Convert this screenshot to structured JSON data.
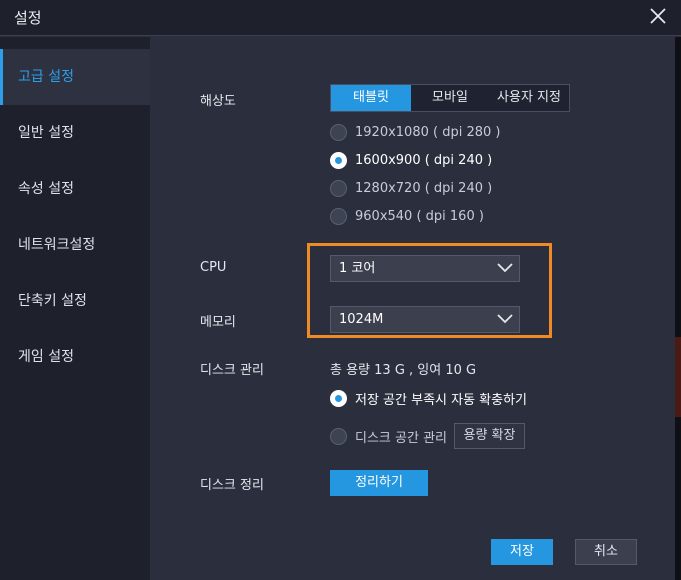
{
  "window": {
    "title": "설정"
  },
  "sidebar": {
    "items": [
      {
        "label": "고급 설정",
        "active": true
      },
      {
        "label": "일반 설정",
        "active": false
      },
      {
        "label": "속성 설정",
        "active": false
      },
      {
        "label": "네트워크설정",
        "active": false
      },
      {
        "label": "단축키 설정",
        "active": false
      },
      {
        "label": "게임 설정",
        "active": false
      }
    ]
  },
  "resolution": {
    "label": "해상도",
    "modes": [
      "태블릿",
      "모바일",
      "사용자 지정"
    ],
    "selected_mode": "태블릿",
    "options": [
      "1920x1080 ( dpi 280 )",
      "1600x900 ( dpi 240 )",
      "1280x720 ( dpi 240 )",
      "960x540 ( dpi 160 )"
    ],
    "selected_option": "1600x900 ( dpi 240 )"
  },
  "cpu": {
    "label": "CPU",
    "value": "1 코어"
  },
  "memory": {
    "label": "메모리",
    "value": "1024M"
  },
  "disk": {
    "label": "디스크 관리",
    "info": "총 용량 13 G , 잉여 10 G",
    "option_auto": "저장 공간 부족시 자동 확충하기",
    "option_manual": "디스크 공간 관리",
    "expand_button": "용량 확장",
    "selected": "auto"
  },
  "cleanup": {
    "label": "디스크 정리",
    "button": "정리하기"
  },
  "footer": {
    "save": "저장",
    "cancel": "취소"
  },
  "colors": {
    "accent": "#2596e0",
    "highlight": "#f08a24"
  }
}
